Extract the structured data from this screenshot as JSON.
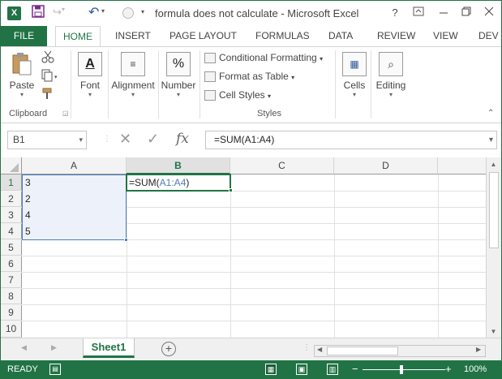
{
  "window": {
    "title": "formula does not calculate - Microsoft Excel",
    "help": "?",
    "app_letter": "X"
  },
  "tabs": [
    {
      "label": "FILE"
    },
    {
      "label": "HOME"
    },
    {
      "label": "INSERT"
    },
    {
      "label": "PAGE LAYOUT"
    },
    {
      "label": "FORMULAS"
    },
    {
      "label": "DATA"
    },
    {
      "label": "REVIEW"
    },
    {
      "label": "VIEW"
    },
    {
      "label": "DEV"
    }
  ],
  "ribbon": {
    "clipboard": {
      "paste": "Paste",
      "label": "Clipboard"
    },
    "font": {
      "label": "Font"
    },
    "alignment": {
      "label": "Alignment"
    },
    "number": {
      "label": "Number",
      "icon_text": "%"
    },
    "styles": {
      "conditional": "Conditional Formatting",
      "format_table": "Format as Table",
      "cell_styles": "Cell Styles",
      "label": "Styles"
    },
    "cells": {
      "label": "Cells"
    },
    "editing": {
      "label": "Editing"
    }
  },
  "formula_bar": {
    "name_box": "B1",
    "fx": "fx",
    "formula": "=SUM(A1:A4)"
  },
  "grid": {
    "columns": [
      "A",
      "B",
      "C",
      "D"
    ],
    "rows": [
      "1",
      "2",
      "3",
      "4",
      "5",
      "6",
      "7",
      "8",
      "9",
      "10"
    ],
    "col_a_values": [
      "3",
      "2",
      "4",
      "5"
    ],
    "b1": {
      "prefix": "=SUM(",
      "ref": "A1:A4",
      "suffix": ")"
    }
  },
  "sheets": {
    "active": "Sheet1",
    "add": "+"
  },
  "status": {
    "mode": "READY",
    "zoom": "100%"
  },
  "colors": {
    "accent": "#217346",
    "selection": "#edf2fa",
    "ref": "#4a7ebb"
  }
}
